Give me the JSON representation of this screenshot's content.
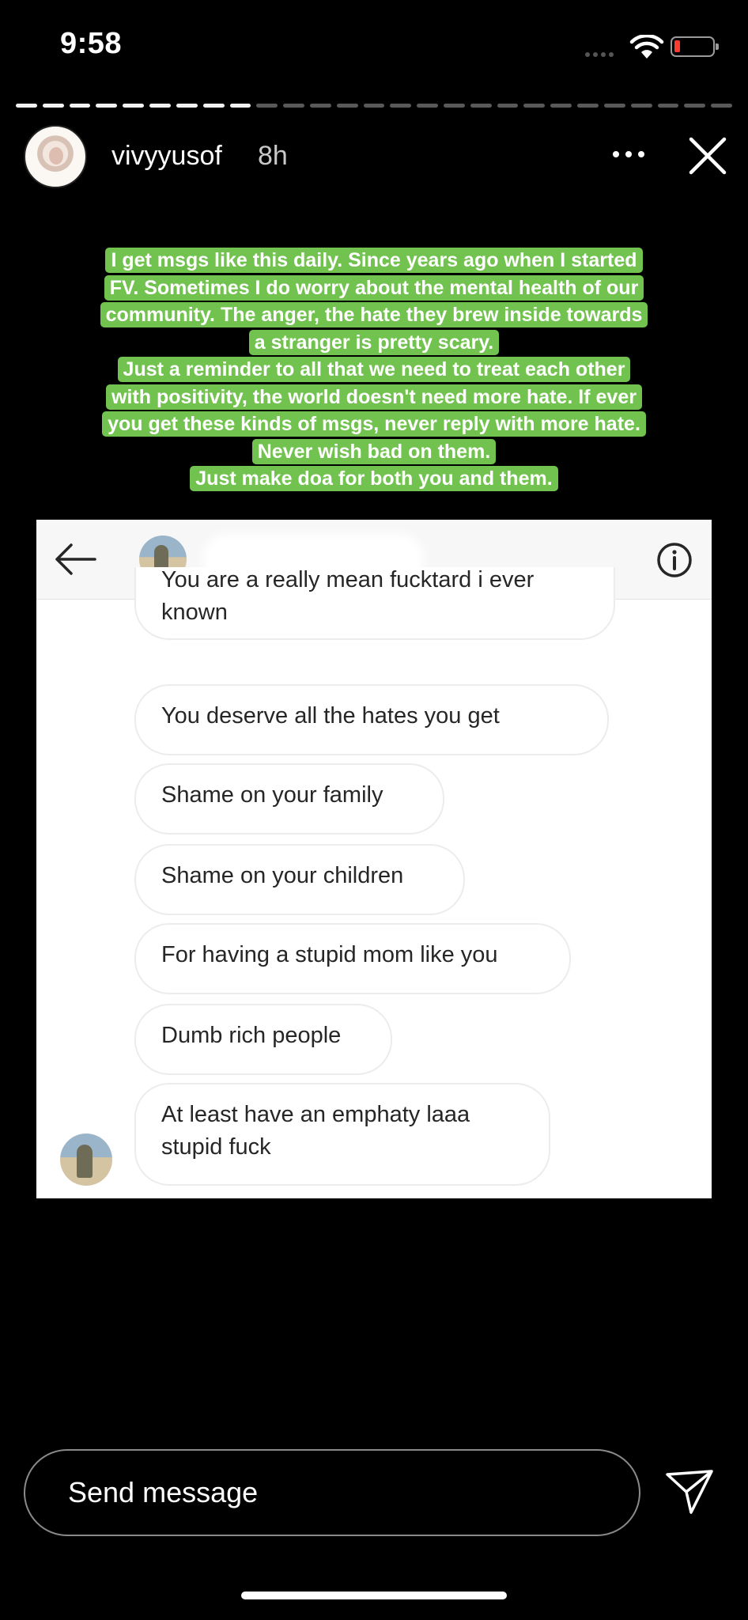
{
  "status_bar": {
    "time": "9:58",
    "battery_level": 0.15,
    "battery_color": "#ff3b30"
  },
  "story_progress": {
    "total_segments": 27,
    "completed_segments": 9
  },
  "header": {
    "username": "vivyyusof",
    "time_ago": "8h",
    "more_icon": "more-horizontal-icon",
    "close_icon": "close-icon"
  },
  "caption": {
    "lines": [
      "I get msgs like this daily. Since years ago when I started",
      "FV. Sometimes I do worry about the mental health of our",
      "community. The anger, the hate they brew inside towards",
      "a stranger is pretty scary.",
      "Just a reminder to all that we need to treat each other",
      "with positivity, the world doesn't need more hate. If ever",
      "you get these kinds of msgs, never reply with more hate.",
      "Never wish bad on them.",
      "Just make doa for both you and them."
    ],
    "highlight_color": "#72c24f"
  },
  "dm_screenshot": {
    "back_icon": "arrow-left-icon",
    "info_icon": "info-icon",
    "messages": [
      "You are a really mean fucktard i ever known",
      "You deserve all the hates you get",
      "Shame on your family",
      "Shame on your children",
      "For having a stupid mom like you",
      "Dumb rich people",
      "At least have an emphaty  laaa stupid fuck"
    ]
  },
  "footer": {
    "message_placeholder": "Send message",
    "send_icon": "paper-plane-icon"
  }
}
